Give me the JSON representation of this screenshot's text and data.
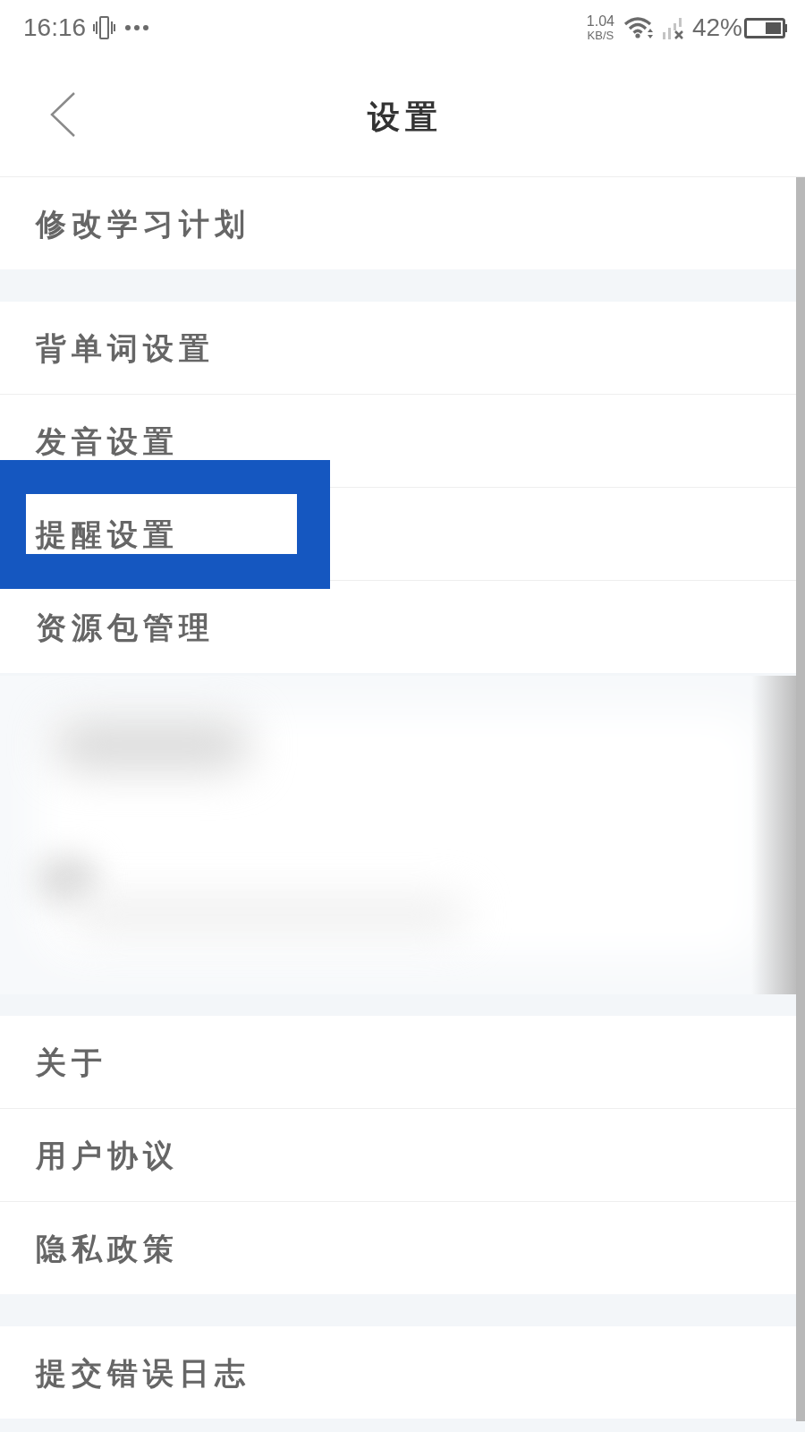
{
  "status_bar": {
    "time": "16:16",
    "network_speed": "1.04",
    "network_speed_unit": "KB/S",
    "battery": "42%"
  },
  "header": {
    "title": "设置"
  },
  "groups": [
    {
      "kind": "list",
      "items": [
        {
          "label": "修改学习计划",
          "highlighted": false
        }
      ]
    },
    {
      "kind": "list",
      "items": [
        {
          "label": "背单词设置",
          "highlighted": false
        },
        {
          "label": "发音设置",
          "highlighted": false
        },
        {
          "label": "提醒设置",
          "highlighted": true
        },
        {
          "label": "资源包管理",
          "highlighted": false
        }
      ]
    },
    {
      "kind": "blurred"
    },
    {
      "kind": "list",
      "items": [
        {
          "label": "关于",
          "highlighted": false
        },
        {
          "label": "用户协议",
          "highlighted": false
        },
        {
          "label": "隐私政策",
          "highlighted": false
        }
      ]
    },
    {
      "kind": "list",
      "items": [
        {
          "label": "提交错误日志",
          "highlighted": false
        }
      ]
    }
  ]
}
